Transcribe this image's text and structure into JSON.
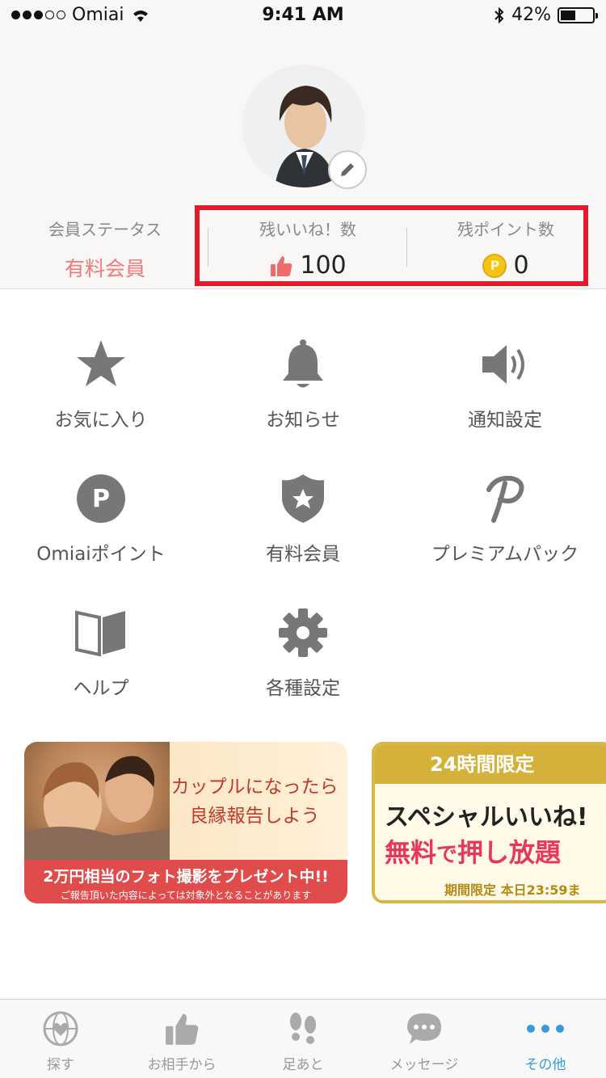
{
  "status_bar": {
    "carrier": "Omiai",
    "time": "9:41 AM",
    "battery": "42%"
  },
  "profile": {
    "member_status_label": "会員ステータス",
    "member_status_value": "有料会員",
    "likes_label": "残いいね！数",
    "likes_value": "100",
    "points_label": "残ポイント数",
    "points_value": "0",
    "coin_symbol": "P"
  },
  "menu": [
    {
      "label": "お気に入り",
      "icon": "star-icon"
    },
    {
      "label": "お知らせ",
      "icon": "bell-icon"
    },
    {
      "label": "通知設定",
      "icon": "speaker-icon"
    },
    {
      "label": "Omiaiポイント",
      "icon": "point-icon"
    },
    {
      "label": "有料会員",
      "icon": "shield-star-icon"
    },
    {
      "label": "プレミアムパック",
      "icon": "premium-p-icon"
    },
    {
      "label": "ヘルプ",
      "icon": "book-icon"
    },
    {
      "label": "各種設定",
      "icon": "gear-icon"
    }
  ],
  "banners": {
    "couple": {
      "line1": "カップルになったら",
      "line2": "良縁報告しよう",
      "footer1": "2万円相当のフォト撮影をプレゼント中!!",
      "footer2": "ご報告頂いた内容によっては対象外となることがあります"
    },
    "special": {
      "header": "24時間限定",
      "line1": "スペシャルいいね!",
      "line2a": "無料",
      "line2b": "で",
      "line2c": "押し放題",
      "footer": "期間限定 本日23:59ま"
    }
  },
  "tabs": [
    {
      "label": "探す",
      "icon": "globe-heart-icon"
    },
    {
      "label": "お相手から",
      "icon": "thumbs-up-icon"
    },
    {
      "label": "足あと",
      "icon": "footprints-icon"
    },
    {
      "label": "メッセージ",
      "icon": "chat-bubble-icon"
    },
    {
      "label": "その他",
      "icon": "more-icon"
    }
  ],
  "colors": {
    "highlight": "#e21a2c",
    "accent": "#3a9ad9",
    "member": "#ef7a7a",
    "icon": "#777777"
  }
}
